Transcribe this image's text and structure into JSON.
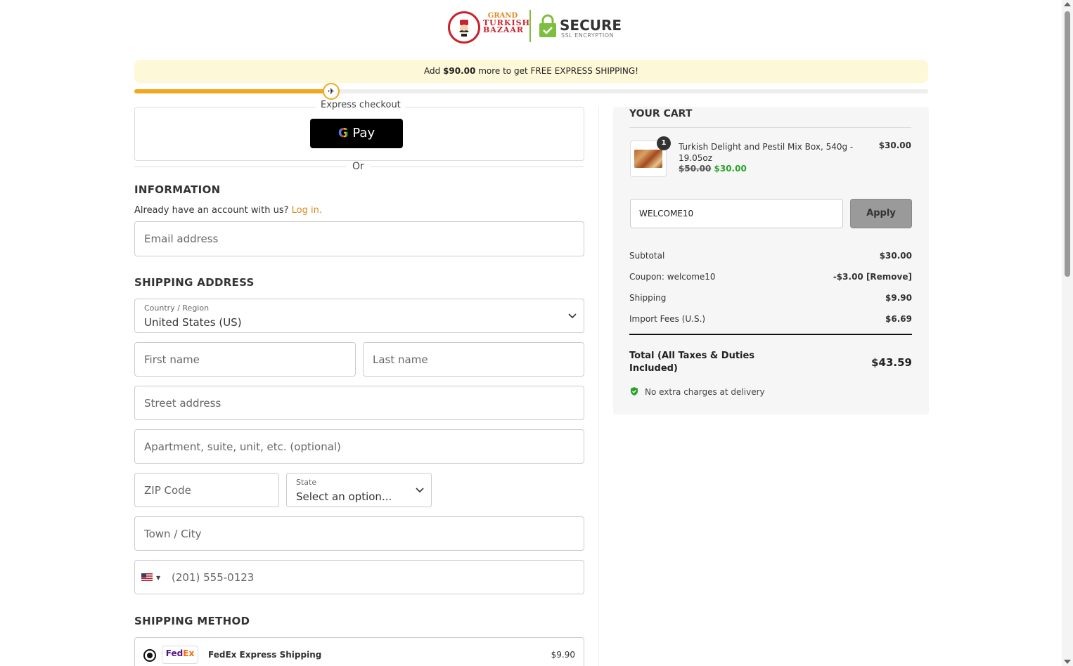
{
  "header": {
    "logo_line1": "GRAND",
    "logo_line2": "TURKISH",
    "logo_line3": "BAZAAR",
    "secure_title": "SECURE",
    "secure_subtitle": "SSL ENCRYPTION"
  },
  "shipping_banner": {
    "prefix": "Add",
    "amount": "$90.00",
    "suffix": "more to get FREE EXPRESS SHIPPING!",
    "progress_fraction": 0.248
  },
  "express": {
    "label": "Express checkout",
    "gpay_g": "G",
    "gpay_text": "Pay",
    "or_label": "Or"
  },
  "information": {
    "title": "INFORMATION",
    "account_prompt": "Already have an account with us?",
    "login_link": "Log in.",
    "email_placeholder": "Email address"
  },
  "shipping_address": {
    "title": "SHIPPING ADDRESS",
    "country_label": "Country / Region",
    "country_value": "United States (US)",
    "first_name_placeholder": "First name",
    "last_name_placeholder": "Last name",
    "street_placeholder": "Street address",
    "apartment_placeholder": "Apartment, suite, unit, etc. (optional)",
    "zip_placeholder": "ZIP Code",
    "state_label": "State",
    "state_value": "Select an option...",
    "city_placeholder": "Town / City",
    "phone_placeholder": "(201) 555-0123"
  },
  "shipping_method": {
    "title": "SHIPPING METHOD",
    "options": [
      {
        "carrier_logo_fed": "Fed",
        "carrier_logo_ex": "Ex",
        "name": "FedEx Express Shipping",
        "price": "$9.90",
        "selected": true
      }
    ]
  },
  "cart": {
    "title": "YOUR CART",
    "items": [
      {
        "quantity": "1",
        "name": "Turkish Delight and Pestil Mix Box, 540g - 19.05oz",
        "old_price": "$50.00",
        "new_price": "$30.00",
        "line_total": "$30.00"
      }
    ],
    "coupon_value": "WELCOME10",
    "apply_label": "Apply",
    "summary": [
      {
        "label": "Subtotal",
        "value": "$30.00"
      },
      {
        "label": "Coupon: welcome10",
        "value": "-$3.00 [Remove]"
      },
      {
        "label": "Shipping",
        "value": "$9.90"
      },
      {
        "label": "Import Fees (U.S.)",
        "value": "$6.69"
      }
    ],
    "total_label": "Total (All Taxes & Duties Included)",
    "total_value": "$43.59",
    "no_extra_charges": "No extra charges at delivery"
  },
  "colors": {
    "accent": "#f2a81d",
    "link": "#d98a1a",
    "sale_green": "#2aa12a",
    "banner_bg": "#fdf8d8",
    "brand_red": "#c8242b",
    "secure_green": "#7fbf3f"
  }
}
